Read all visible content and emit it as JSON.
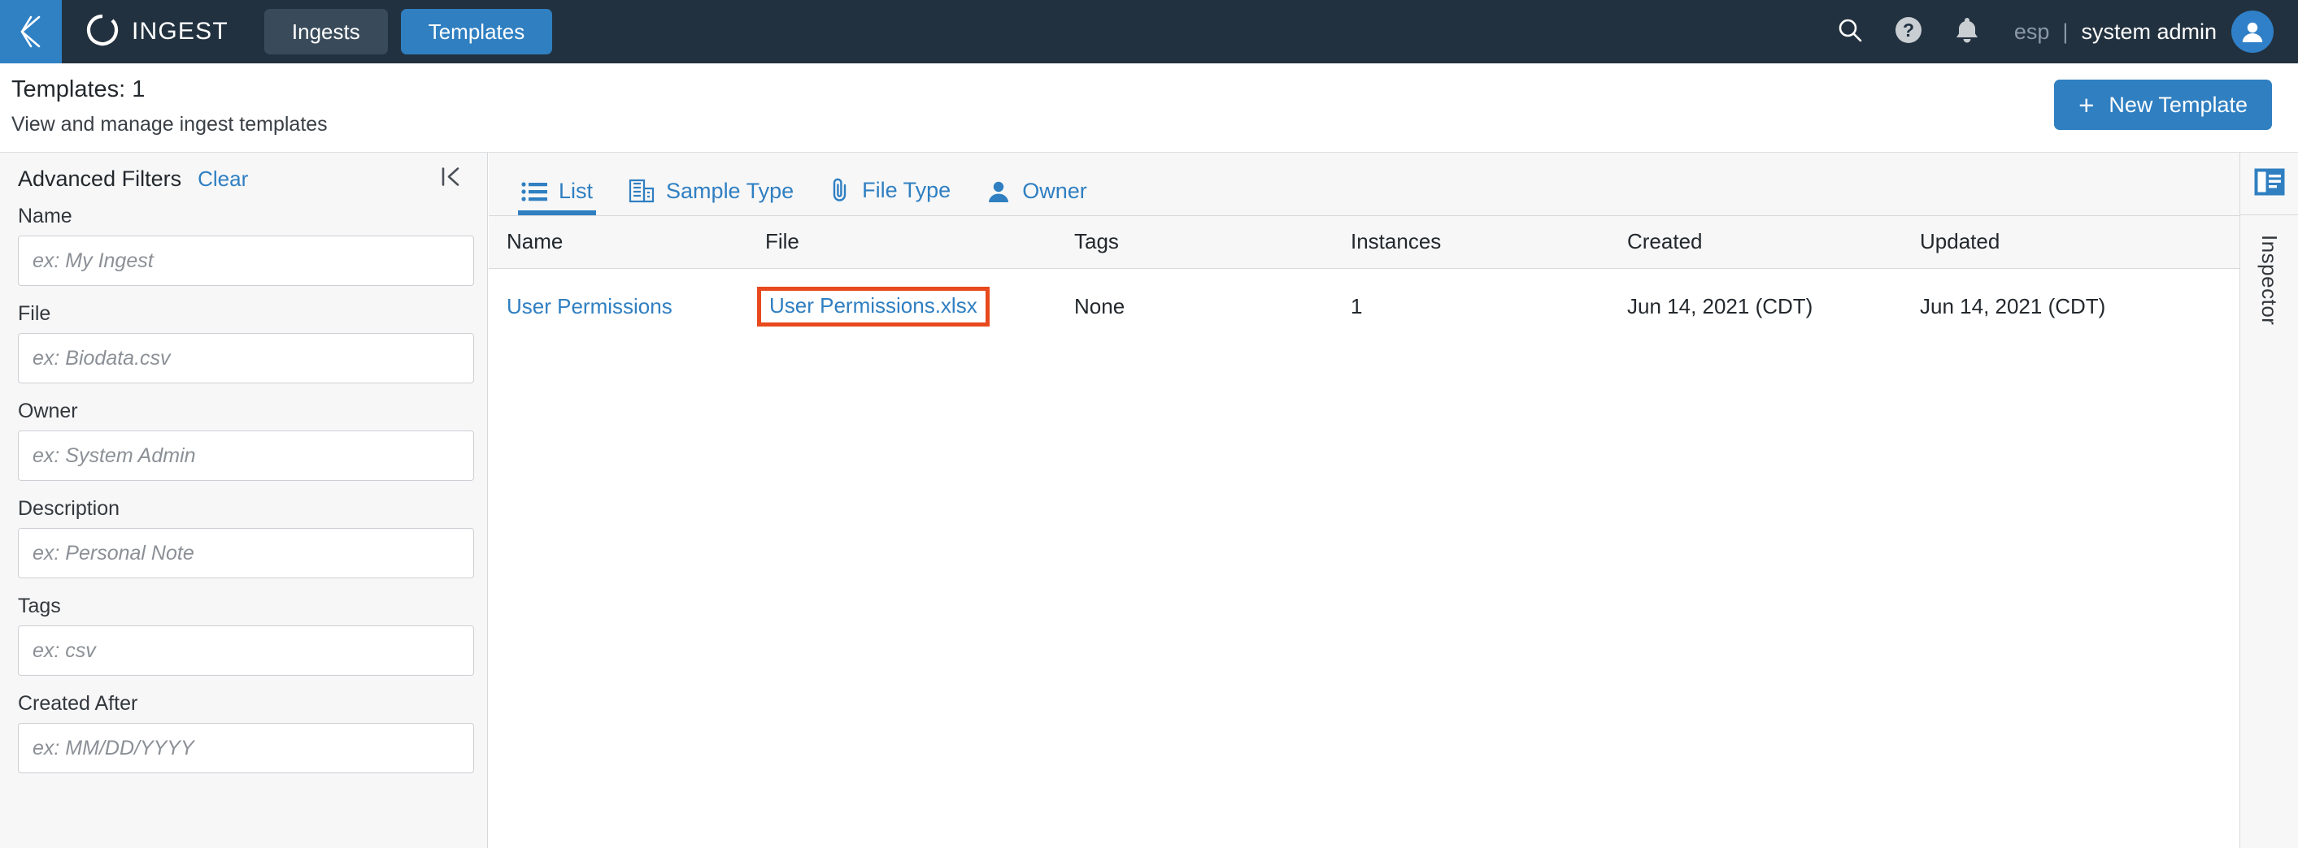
{
  "topbar": {
    "back_icon": "back-chevron-icon",
    "brand_logo_icon": "ingest-ring-logo-icon",
    "brand_name": "INGEST",
    "nav_tabs": [
      {
        "label": "Ingests",
        "active": false
      },
      {
        "label": "Templates",
        "active": true
      }
    ],
    "icons": [
      {
        "name": "search-icon"
      },
      {
        "name": "help-icon"
      },
      {
        "name": "notifications-bell-icon"
      }
    ],
    "tenant": "esp",
    "separator": "|",
    "user_name": "system admin",
    "avatar_icon": "user-avatar-icon",
    "bg_color": "#22313f",
    "back_tile_color": "#3080c4",
    "active_tab_color": "#2f7fc1",
    "inactive_tab_color": "#394b5a"
  },
  "page_header": {
    "title": "Templates: 1",
    "subtitle": "View and manage ingest templates",
    "new_template_label": "New Template",
    "new_template_plus": "+",
    "button_color": "#2f7fc1"
  },
  "sidebar": {
    "title": "Advanced Filters",
    "clear_label": "Clear",
    "collapse_icon": "collapse-panel-icon",
    "fields": [
      {
        "label": "Name",
        "placeholder": "ex: My Ingest",
        "value": ""
      },
      {
        "label": "File",
        "placeholder": "ex: Biodata.csv",
        "value": ""
      },
      {
        "label": "Owner",
        "placeholder": "ex: System Admin",
        "value": ""
      },
      {
        "label": "Description",
        "placeholder": "ex: Personal Note",
        "value": ""
      },
      {
        "label": "Tags",
        "placeholder": "ex: csv",
        "value": ""
      },
      {
        "label": "Created After",
        "placeholder": "ex: MM/DD/YYYY",
        "value": ""
      }
    ],
    "bg_color": "#f7f7f8",
    "link_color": "#2f7fc1"
  },
  "main": {
    "tabs": [
      {
        "label": "List",
        "icon": "list-icon",
        "active": true
      },
      {
        "label": "Sample Type",
        "icon": "grid-building-icon",
        "active": false
      },
      {
        "label": "File Type",
        "icon": "paperclip-icon",
        "active": false
      },
      {
        "label": "Owner",
        "icon": "person-icon",
        "active": false
      }
    ],
    "table": {
      "columns": [
        "Name",
        "File",
        "Tags",
        "Instances",
        "Created",
        "Updated"
      ],
      "rows": [
        {
          "name": "User Permissions",
          "file": "User Permissions.xlsx",
          "tags": "None",
          "instances": "1",
          "created": "Jun 14, 2021 (CDT)",
          "updated": "Jun 14, 2021 (CDT)",
          "file_highlighted": true
        }
      ],
      "highlight_color": "#e8491d",
      "link_color": "#2f7fc1"
    }
  },
  "inspector": {
    "label": "Inspector",
    "toggle_icon": "inspector-panel-icon",
    "icon_color": "#2f7fc1"
  }
}
